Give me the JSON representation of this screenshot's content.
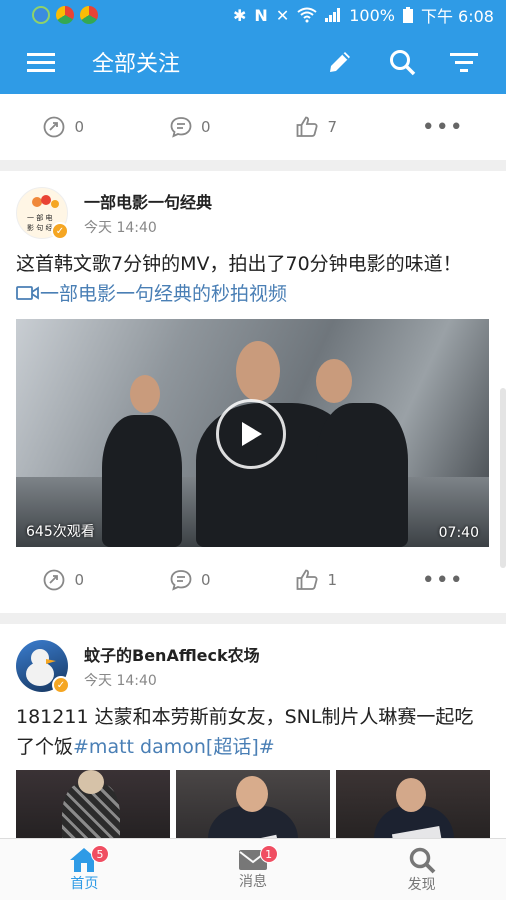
{
  "status_bar": {
    "battery": "100%",
    "time": "下午 6:08"
  },
  "header": {
    "title": "全部关注"
  },
  "post0": {
    "repost_count": "0",
    "comment_count": "0",
    "like_count": "7"
  },
  "post1": {
    "author": "一部电影一句经典",
    "time": "今天 14:40",
    "text": "这首韩文歌7分钟的MV，拍出了70分钟电影的味道！",
    "link_text": "一部电影一句经典的秒拍视频",
    "video_views": "645次观看",
    "video_duration": "07:40",
    "repost_count": "0",
    "comment_count": "0",
    "like_count": "1"
  },
  "post2": {
    "author": "蚊子的BenAffleck农场",
    "time": "今天 14:40",
    "text": "181211 达蒙和本劳斯前女友，SNL制片人琳赛一起吃了个饭",
    "hashtag": "#matt damon[超话]#"
  },
  "bottom_nav": [
    {
      "label": "首页",
      "badge": "5",
      "icon": "home-icon"
    },
    {
      "label": "消息",
      "badge": "1",
      "icon": "mail-icon"
    },
    {
      "label": "发现",
      "badge": "",
      "icon": "search-icon"
    }
  ],
  "colors": {
    "brand": "#2f9be6",
    "link": "#4a7fb5",
    "badge": "#f04e62"
  }
}
